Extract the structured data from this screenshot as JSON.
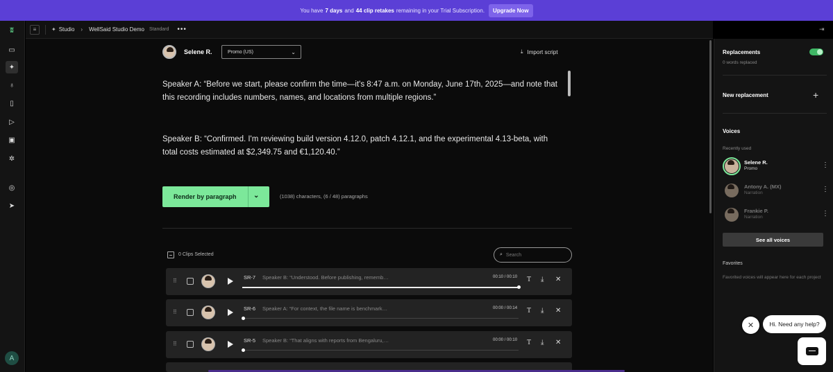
{
  "banner": {
    "prefix": "You have",
    "days": "7 days",
    "and": "and",
    "retakes": "44 clip retakes",
    "suffix": "remaining in your Trial Subscription.",
    "upgrade": "Upgrade Now",
    "color": "#5b3fd6"
  },
  "sidebar": {
    "avatar_initial": "A",
    "icons": [
      "logo-icon",
      "folder-icon",
      "waveform-icon",
      "mic-icon",
      "book-icon",
      "play-icon",
      "image-icon",
      "puzzle-icon",
      "lightbulb-icon",
      "send-icon"
    ]
  },
  "topbar": {
    "studio": "Studio",
    "project": "WellSaid Studio Demo",
    "plan": "Standard"
  },
  "editor": {
    "voice_name": "Selene R.",
    "style": "Promo (US)",
    "import_label": "Import script",
    "paragraph1": "Speaker A: “Before we start, please confirm the time—it's 8:47 a.m. on Monday, June 17th, 2025—and note that this recording includes numbers, names, and locations from multiple regions.”",
    "paragraph2": "Speaker B: “Confirmed. I'm reviewing build version 4.12.0, patch 4.12.1, and the experimental 4.13-beta, with total costs estimated at $2,349.75 and €1,120.40.”",
    "render_label": "Render by paragraph",
    "char_count": "(1038) characters, (6 / 48) paragraphs",
    "accent": "#7ce89a"
  },
  "clips": {
    "selected_label": "0 Clips Selected",
    "search_placeholder": "Search",
    "items": [
      {
        "id": "SR-7",
        "text": "Speaker B: “Understood. Before publishing, rememb…",
        "time": "00:10 / 00:10",
        "progress": 1.0
      },
      {
        "id": "SR-6",
        "text": "Speaker A: “For context, the file name is benchmark…",
        "time": "00:00 / 00:14",
        "progress": 0.0
      },
      {
        "id": "SR-5",
        "text": "Speaker B: “That aligns with reports from Bengaluru,…",
        "time": "00:00 / 00:10",
        "progress": 0.0
      }
    ]
  },
  "right_panel": {
    "replacements_title": "Replacements",
    "replacements_sub": "0 words replaced",
    "replacements_on": true,
    "new_replacement": "New replacement",
    "voices_title": "Voices",
    "recently_used": "Recently used",
    "voices": [
      {
        "name": "Selene R.",
        "style": "Promo"
      },
      {
        "name": "Antony A. (MX)",
        "style": "Narration"
      },
      {
        "name": "Frankie P.",
        "style": "Narration"
      }
    ],
    "see_all": "See all voices",
    "favorites_title": "Favorites",
    "favorites_text": "Favorited voices will appear here for each project"
  },
  "chat": {
    "bubble": "Hi. Need any help?"
  }
}
